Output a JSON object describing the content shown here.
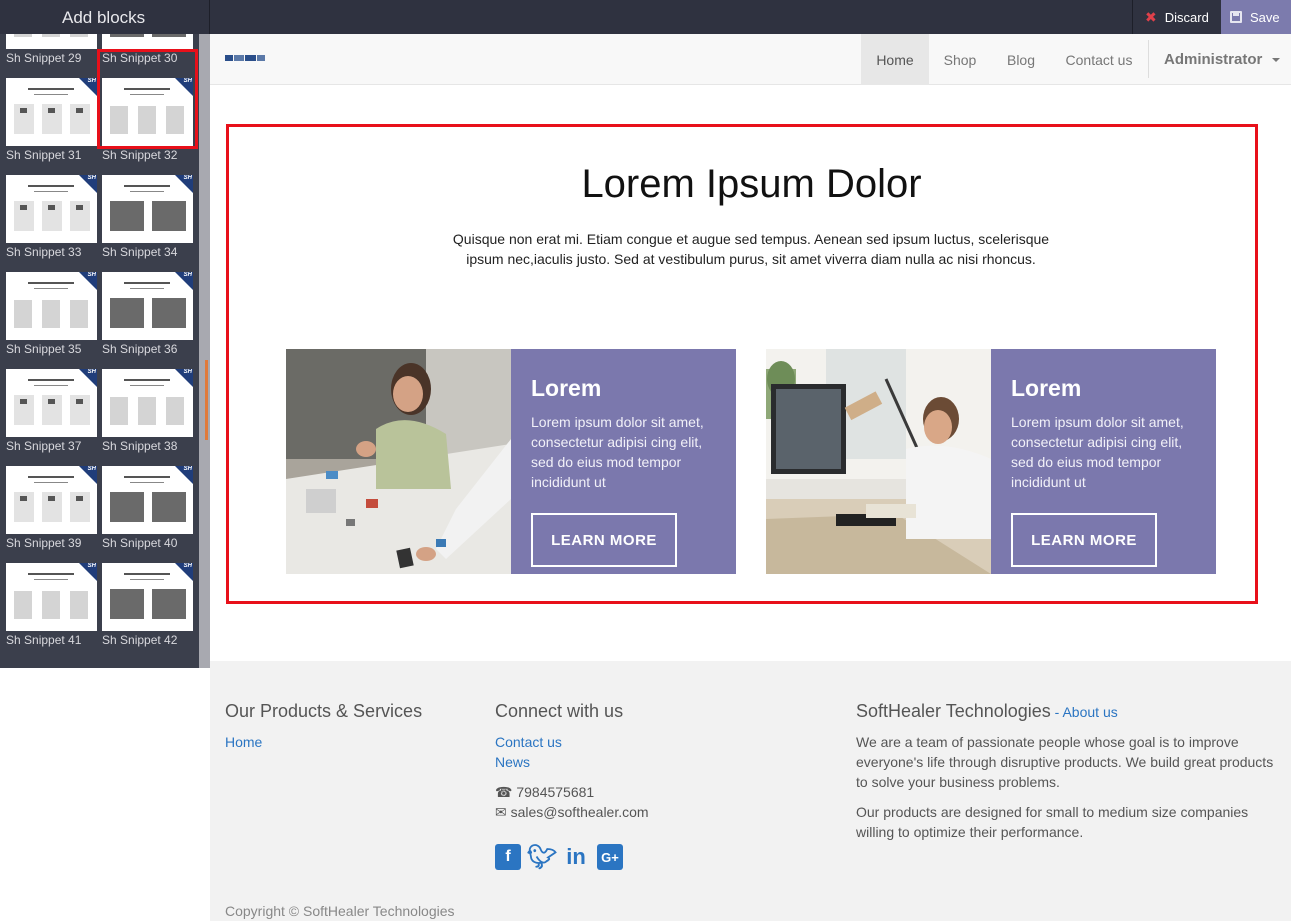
{
  "editor": {
    "title": "Add blocks",
    "discard_label": "Discard",
    "save_label": "Save"
  },
  "sidebar": {
    "snippets": [
      "Sh Snippet 29",
      "Sh Snippet 30",
      "Sh Snippet 31",
      "Sh Snippet 32",
      "Sh Snippet 33",
      "Sh Snippet 34",
      "Sh Snippet 35",
      "Sh Snippet 36",
      "Sh Snippet 37",
      "Sh Snippet 38",
      "Sh Snippet 39",
      "Sh Snippet 40",
      "Sh Snippet 41",
      "Sh Snippet 42"
    ],
    "selected": "Sh Snippet 32",
    "corner_badge": "SH"
  },
  "nav": {
    "items": [
      "Home",
      "Shop",
      "Blog",
      "Contact us"
    ],
    "active": "Home",
    "user": "Administrator"
  },
  "hero": {
    "title": "Lorem Ipsum Dolor",
    "text": "Quisque non erat mi. Etiam congue et augue sed tempus. Aenean sed ipsum luctus, scelerisque ipsum nec,iaculis justo. Sed at vestibulum purus, sit amet viverra diam nulla ac nisi rhoncus.",
    "cards": [
      {
        "title": "Lorem",
        "text": "Lorem ipsum dolor sit amet, consectetur adipisi cing elit, sed do eius mod tempor incididunt ut",
        "button": "LEARN MORE"
      },
      {
        "title": "Lorem",
        "text": "Lorem ipsum dolor sit amet, consectetur adipisi cing elit, sed do eius mod tempor incididunt ut",
        "button": "LEARN MORE"
      }
    ]
  },
  "footer": {
    "col1": {
      "heading": "Our Products & Services",
      "links": [
        "Home"
      ]
    },
    "col2": {
      "heading": "Connect with us",
      "links": [
        "Contact us",
        "News"
      ],
      "phone": "7984575681",
      "email": "sales@softhealer.com"
    },
    "col3": {
      "heading": "SoftHealer Technologies",
      "separator": " - ",
      "about_link": "About us",
      "para1": "We are a team of passionate people whose goal is to improve everyone's life through disruptive products. We build great products to solve your business problems.",
      "para2": "Our products are designed for small to medium size companies willing to optimize their performance."
    },
    "social_icons": [
      "facebook-icon",
      "twitter-icon",
      "linkedin-icon",
      "google-plus-icon"
    ],
    "copyright": "Copyright © SoftHealer Technologies"
  },
  "colors": {
    "editor_bar": "#2f3240",
    "sidebar": "#3b3f4c",
    "save": "#7c7bad",
    "card_panel": "#7b78ad",
    "selection": "#e8101a",
    "link": "#2b75c2"
  }
}
